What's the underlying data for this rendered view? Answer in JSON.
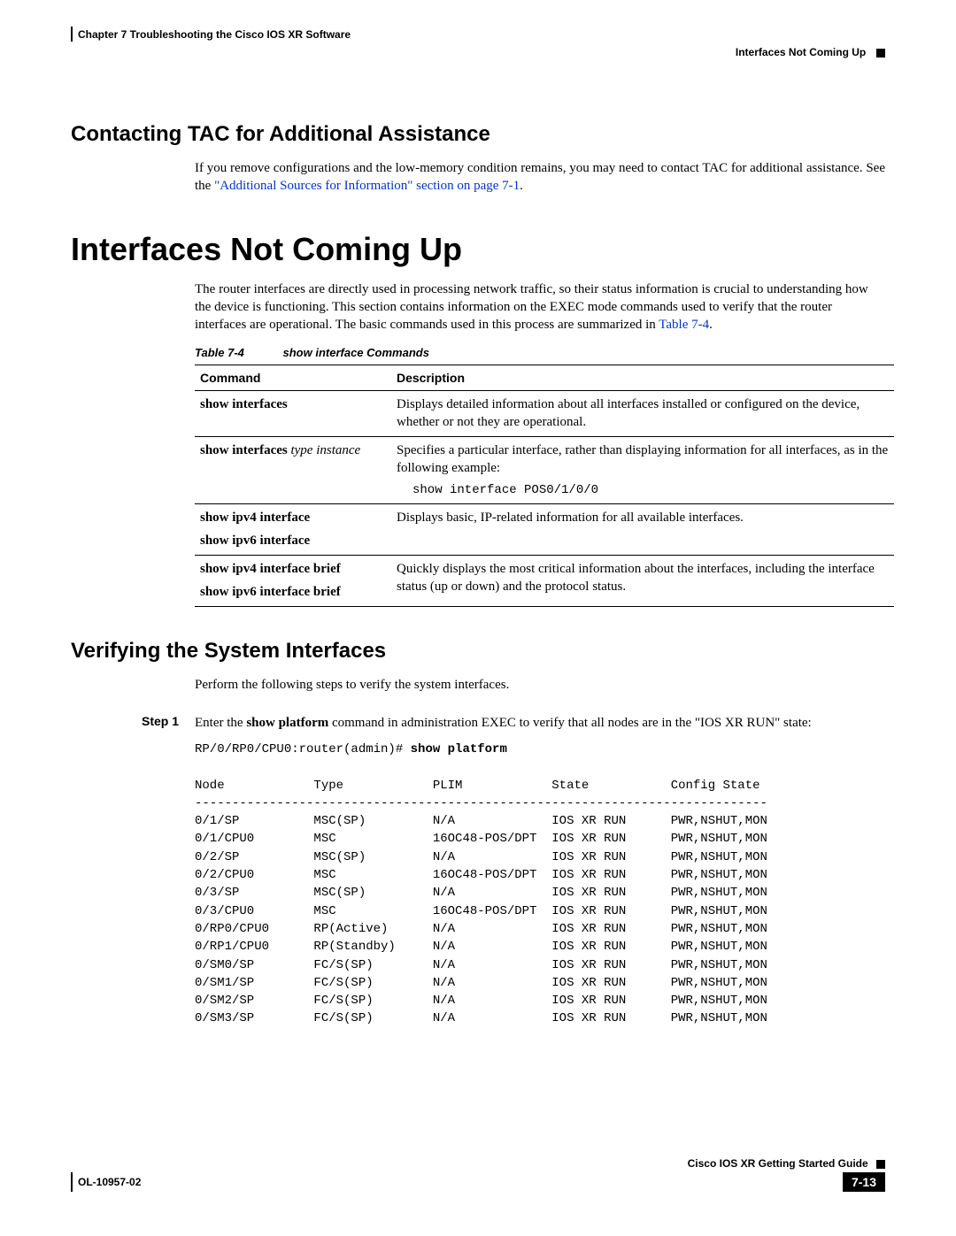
{
  "header": {
    "chapter": "Chapter 7    Troubleshooting the Cisco IOS XR Software",
    "breadcrumb": "Interfaces Not Coming Up"
  },
  "section1": {
    "heading": "Contacting TAC for Additional Assistance",
    "para_pre": "If you remove configurations and the low-memory condition remains, you may need to contact TAC for additional assistance. See the ",
    "link": "\"Additional Sources for Information\" section on page 7-1",
    "para_post": "."
  },
  "main": {
    "heading": "Interfaces Not Coming Up",
    "para_pre": "The router interfaces are directly used in processing network traffic, so their status information is crucial to understanding how the device is functioning. This section contains information on the EXEC mode commands used to verify that the router interfaces are operational. The basic commands used in this process are summarized in ",
    "table_ref": "Table 7-4",
    "para_post": "."
  },
  "table": {
    "caption_label": "Table 7-4",
    "caption_title": "show interface Commands",
    "headers": {
      "col1": "Command",
      "col2": "Description"
    },
    "rows": [
      {
        "cmd": "show interfaces",
        "desc": "Displays detailed information about all interfaces installed or configured on the device, whether or not they are operational."
      },
      {
        "cmd_bold": "show interfaces",
        "cmd_ital": " type instance",
        "desc": "Specifies a particular interface, rather than displaying information for all interfaces, as in the following example:",
        "code": "show interface POS0/1/0/0"
      },
      {
        "cmd1": "show ipv4 interface",
        "cmd2": "show ipv6 interface",
        "desc": "Displays basic, IP-related information for all available interfaces."
      },
      {
        "cmd1": "show ipv4 interface brief",
        "cmd2": "show ipv6 interface brief",
        "desc": "Quickly displays the most critical information about the interfaces, including the interface status (up or down) and the protocol status."
      }
    ]
  },
  "section2": {
    "heading": "Verifying the System Interfaces",
    "para": "Perform the following steps to verify the system interfaces.",
    "step_label": "Step 1",
    "step_pre": "Enter the ",
    "step_cmd": "show platform",
    "step_post": " command in administration EXEC to verify that all nodes are in the \"IOS XR RUN\" state:",
    "cmd_prompt": "RP/0/RP0/CPU0:router(admin)# ",
    "cmd_command": "show platform",
    "output": "\nNode            Type            PLIM            State           Config State\n-----------------------------------------------------------------------------\n0/1/SP          MSC(SP)         N/A             IOS XR RUN      PWR,NSHUT,MON\n0/1/CPU0        MSC             16OC48-POS/DPT  IOS XR RUN      PWR,NSHUT,MON\n0/2/SP          MSC(SP)         N/A             IOS XR RUN      PWR,NSHUT,MON\n0/2/CPU0        MSC             16OC48-POS/DPT  IOS XR RUN      PWR,NSHUT,MON\n0/3/SP          MSC(SP)         N/A             IOS XR RUN      PWR,NSHUT,MON\n0/3/CPU0        MSC             16OC48-POS/DPT  IOS XR RUN      PWR,NSHUT,MON\n0/RP0/CPU0      RP(Active)      N/A             IOS XR RUN      PWR,NSHUT,MON\n0/RP1/CPU0      RP(Standby)     N/A             IOS XR RUN      PWR,NSHUT,MON\n0/SM0/SP        FC/S(SP)        N/A             IOS XR RUN      PWR,NSHUT,MON\n0/SM1/SP        FC/S(SP)        N/A             IOS XR RUN      PWR,NSHUT,MON\n0/SM2/SP        FC/S(SP)        N/A             IOS XR RUN      PWR,NSHUT,MON\n0/SM3/SP        FC/S(SP)        N/A             IOS XR RUN      PWR,NSHUT,MON"
  },
  "footer": {
    "guide": "Cisco IOS XR Getting Started Guide",
    "docnum": "OL-10957-02",
    "pagenum": "7-13"
  }
}
